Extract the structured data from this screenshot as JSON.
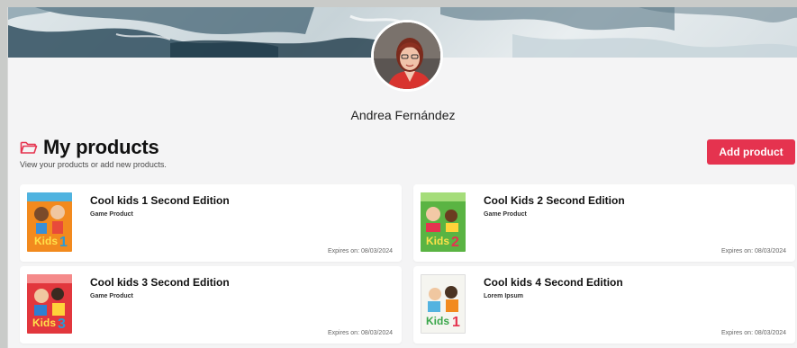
{
  "profile": {
    "name": "Andrea Fernández"
  },
  "section": {
    "title": "My products",
    "subtitle": "View your products or add new products.",
    "add_button_label": "Add product"
  },
  "products": [
    {
      "title": "Cool kids 1 Second Edition",
      "type": "Game Product",
      "expires": "Expires on: 08/03/2024",
      "cover_color": "#f28a1e",
      "cover_number": "1"
    },
    {
      "title": "Cool Kids 2 Second Edition",
      "type": "Game Product",
      "expires": "Expires on: 08/03/2024",
      "cover_color": "#5ab443",
      "cover_number": "2"
    },
    {
      "title": "Cool kids 3 Second Edition",
      "type": "Game Product",
      "expires": "Expires on: 08/03/2024",
      "cover_color": "#e2373d",
      "cover_number": "3"
    },
    {
      "title": "Cool kids 4 Second Edition",
      "type": "Lorem Ipsum",
      "expires": "Expires on: 08/03/2024",
      "cover_color": "#f5f5f0",
      "cover_number": "1"
    }
  ],
  "colors": {
    "accent": "#e5334f",
    "page_bg": "#f4f4f5"
  },
  "icons": {
    "section_icon": "folder-icon"
  }
}
